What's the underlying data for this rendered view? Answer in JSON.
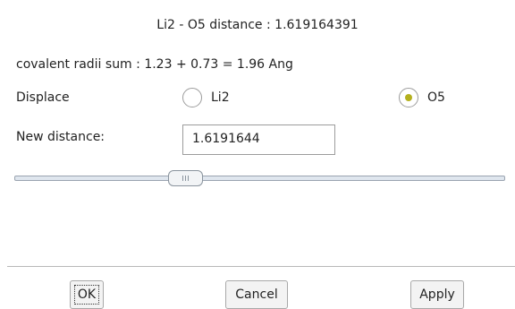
{
  "dialog": {
    "title": "Li2 - O5 distance : 1.619164391",
    "radii_text": "covalent radii sum : 1.23 + 0.73 = 1.96 Ang"
  },
  "displace": {
    "label": "Displace",
    "options": [
      {
        "label": "Li2",
        "selected": false
      },
      {
        "label": "O5",
        "selected": true
      }
    ]
  },
  "new_distance": {
    "label": "New distance:",
    "value": "1.6191644"
  },
  "buttons": {
    "ok": "OK",
    "cancel": "Cancel",
    "apply": "Apply"
  },
  "colors": {
    "radio_selected_dot": "#b4b01e"
  },
  "icons": {
    "slider_thumb": "grip-icon"
  }
}
